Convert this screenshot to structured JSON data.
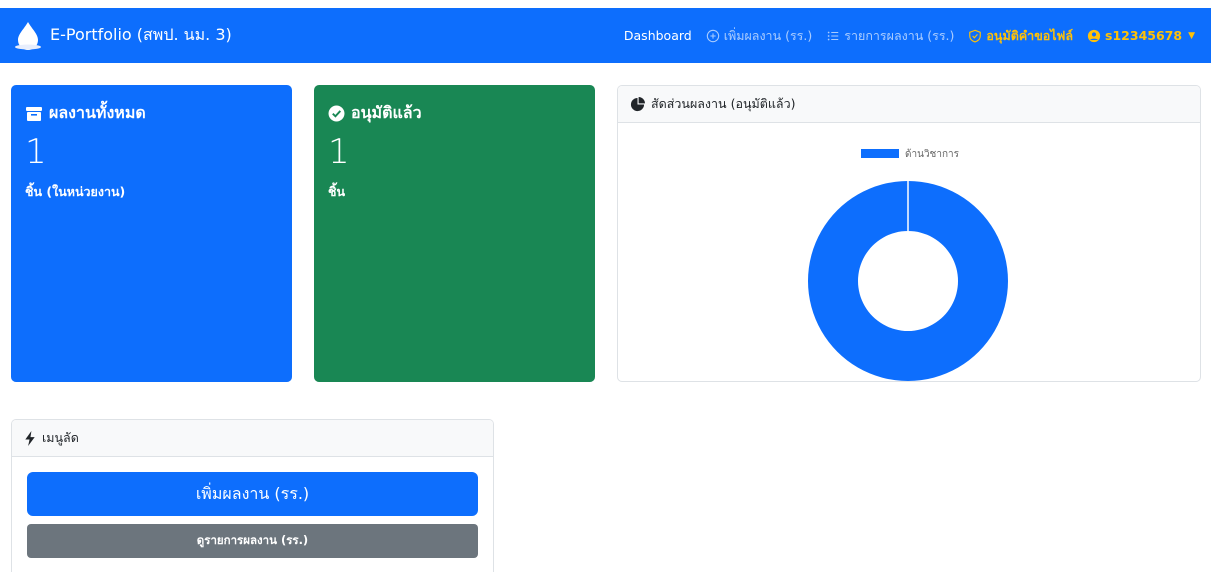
{
  "navbar": {
    "brand": "E-Portfolio (สพป. นม. 3)",
    "links": {
      "dashboard": "Dashboard",
      "add_work": "เพิ่มผลงาน (รร.)",
      "work_list": "รายการผลงาน (รร.)",
      "approve_files": "อนุมัติคำขอไฟล์",
      "user": "s12345678"
    },
    "colors": {
      "bar": "#0d6efd",
      "highlight": "#ffc107"
    }
  },
  "stats": {
    "total": {
      "title": "ผลงานทั้งหมด",
      "value": "1",
      "unit": "ชิ้น (ในหน่วยงาน)",
      "icon": "box-icon",
      "color": "#0d6efd"
    },
    "approved": {
      "title": "อนุมัติแล้ว",
      "value": "1",
      "unit": "ชิ้น",
      "icon": "check-circle-icon",
      "color": "#198754"
    }
  },
  "chart_panel": {
    "title": "สัดส่วนผลงาน (อนุมัติแล้ว)",
    "icon": "pie-chart-icon"
  },
  "chart_data": {
    "type": "pie",
    "donut": true,
    "title": "",
    "legend_position": "top",
    "categories": [
      "ด้านวิชาการ"
    ],
    "values": [
      1
    ],
    "colors": [
      "#0d6efd"
    ]
  },
  "quick_menu": {
    "title": "เมนูลัด",
    "icon": "lightning-icon",
    "add_button": "เพิ่มผลงาน (รร.)",
    "list_button": "ดูรายการผลงาน (รร.)"
  }
}
